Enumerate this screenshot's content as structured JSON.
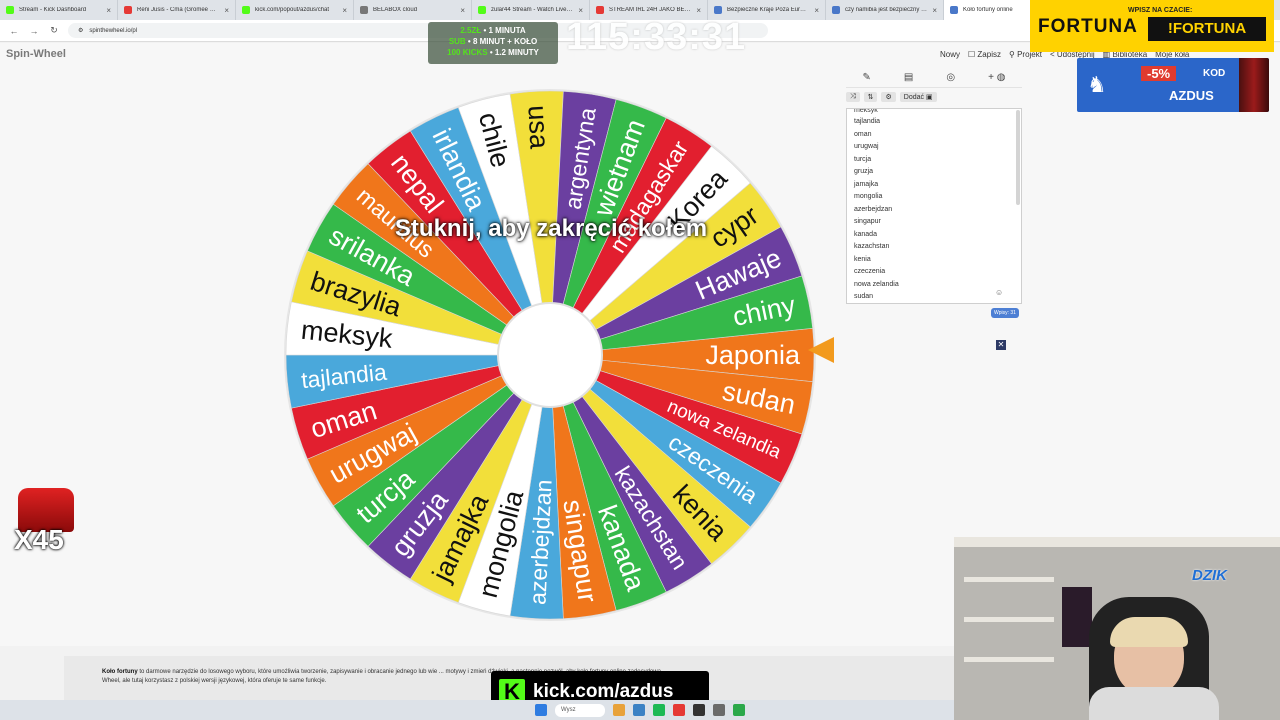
{
  "browser": {
    "tabs": [
      {
        "title": "Stream - Kick Dashboard",
        "color": "#53fc18"
      },
      {
        "title": "Reni Jusis - Ćma (Gromee Remix)",
        "color": "#e53935"
      },
      {
        "title": "kick.com/popout/azdus/chat",
        "color": "#53fc18"
      },
      {
        "title": "BELABOX cloud",
        "color": "#777777"
      },
      {
        "title": "zular44 Stream - Watch Live on Kick",
        "color": "#53fc18"
      },
      {
        "title": "STREAM IRL 24H JAKO BEZDOMNY",
        "color": "#e53935"
      },
      {
        "title": "Bezpieczne Kraje Poza Europą",
        "color": "#4a78c9"
      },
      {
        "title": "czy namibia jest bezpieczny - Szukaj",
        "color": "#4a78c9"
      },
      {
        "title": "Koło fortuny online",
        "color": "#4a78c9",
        "active": true
      }
    ],
    "url": "spinthewheel.io/pl"
  },
  "app": {
    "logo": "Spin-Wheel",
    "menu": [
      "Nowy",
      "☐ Zapisz",
      "⚲ Projekt",
      "< Udostępnij",
      "▥ Biblioteka",
      "Moje koła"
    ]
  },
  "wheel": {
    "banner": "Stuknij, aby zakręcić kołem",
    "segments": [
      {
        "label": "Japonia",
        "color": "#f0761b"
      },
      {
        "label": "sudan",
        "color": "#f0761b"
      },
      {
        "label": "nowa zelandia",
        "color": "#e21f2f"
      },
      {
        "label": "czeczenia",
        "color": "#4aa8db"
      },
      {
        "label": "kenia",
        "color": "#f2df3a"
      },
      {
        "label": "kazachstan",
        "color": "#6b3fa0"
      },
      {
        "label": "kanada",
        "color": "#35b94a"
      },
      {
        "label": "singapur",
        "color": "#f0761b"
      },
      {
        "label": "azerbejdzan",
        "color": "#4aa8db"
      },
      {
        "label": "mongolia",
        "color": "#ffffff"
      },
      {
        "label": "jamajka",
        "color": "#f2df3a"
      },
      {
        "label": "gruzja",
        "color": "#6b3fa0"
      },
      {
        "label": "turcja",
        "color": "#35b94a"
      },
      {
        "label": "urugwaj",
        "color": "#f0761b"
      },
      {
        "label": "oman",
        "color": "#e21f2f"
      },
      {
        "label": "tajlandia",
        "color": "#4aa8db"
      },
      {
        "label": "meksyk",
        "color": "#ffffff"
      },
      {
        "label": "brazylia",
        "color": "#f2df3a"
      },
      {
        "label": "srilanka",
        "color": "#35b94a"
      },
      {
        "label": "mauritius",
        "color": "#f0761b"
      },
      {
        "label": "nepal",
        "color": "#e21f2f"
      },
      {
        "label": "irlandia",
        "color": "#4aa8db"
      },
      {
        "label": "chile",
        "color": "#ffffff"
      },
      {
        "label": "usa",
        "color": "#f2df3a"
      },
      {
        "label": "argentyna",
        "color": "#6b3fa0"
      },
      {
        "label": "wietnam",
        "color": "#35b94a"
      },
      {
        "label": "madagaskar",
        "color": "#e21f2f"
      },
      {
        "label": "Korea",
        "color": "#ffffff"
      },
      {
        "label": "cypr",
        "color": "#f2df3a"
      },
      {
        "label": "Hawaje",
        "color": "#6b3fa0"
      },
      {
        "label": "chiny",
        "color": "#35b94a"
      }
    ],
    "pointer_color": "#f29a1d"
  },
  "editor": {
    "tab_icons": [
      "✎",
      "▤",
      "◎",
      "+ ◍"
    ],
    "tools": [
      "⤨",
      "⇅",
      "⚙",
      "Dodać ▣"
    ],
    "entries_top_partial": "meksyk",
    "entries": [
      "tajlandia",
      "oman",
      "urugwaj",
      "turcja",
      "gruzja",
      "jamajka",
      "mongolia",
      "azerbejdzan",
      "singapur",
      "kanada",
      "kazachstan",
      "kenia",
      "czeczenia",
      "nowa zelandia",
      "sudan"
    ],
    "entry_count": "Wpisy: 31",
    "smile": "☺",
    "close": "✕"
  },
  "overlays": {
    "timer": "115:33:31",
    "rules": [
      {
        "price": "2.5ZŁ",
        "text": " • 1 MINUTA"
      },
      {
        "price": "SUB",
        "text": " • 8 MINUT + KOŁO"
      },
      {
        "price": "100 KICKS",
        "text": " • 1.2 MINUTY"
      }
    ],
    "fortuna_hint": "WPISZ NA CZACIE:",
    "fortuna_brand": "FORTUNA",
    "fortuna_code": "!FORTUNA",
    "dzik_percent": "-5%",
    "dzik_kod": "KOD",
    "dzik_name": "AZDUS",
    "shorts_count": "X45",
    "kick_logo": "K",
    "kick_url": "kick.com/azdus",
    "webcam_brand": "DZIK"
  },
  "footer": {
    "title": "Koło fortuny",
    "line1": " to darmowe narzędzie do losowego wyboru, które umożliwia tworzenie, zapisywanie i obracanie jednego lub wie ... motywy i zmień dźwięki, a następnie pozwól, aby koło fortuny online zadecydowa",
    "line2": "Wheel, ale tutaj korzystasz z polskiej wersji językowej, która oferuje te same funkcje."
  },
  "taskbar": {
    "search": "Wysz"
  }
}
